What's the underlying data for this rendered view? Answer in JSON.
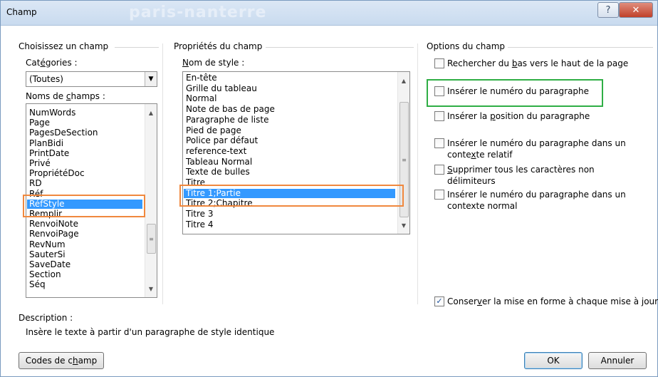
{
  "window": {
    "title": "Champ",
    "background_title": "paris-nanterre"
  },
  "left": {
    "group_title": "Choisissez un champ",
    "categories_label": "Catégories :",
    "categories_value": "(Toutes)",
    "names_label": "Noms de champs :",
    "field_names": [
      "NumWords",
      "Page",
      "PagesDeSection",
      "PlanBidi",
      "PrintDate",
      "Privé",
      "PropriétéDoc",
      "RD",
      "Réf",
      "RéfStyle",
      "Remplir",
      "RenvoiNote",
      "RenvoiPage",
      "RevNum",
      "SauterSi",
      "SaveDate",
      "Section",
      "Séq"
    ],
    "selected_field": "RéfStyle"
  },
  "middle": {
    "group_title": "Propriétés du champ",
    "style_label": "Nom de style :",
    "styles": [
      "En-tête",
      "Grille du tableau",
      "Normal",
      "Note de bas de page",
      "Paragraphe de liste",
      "Pied de page",
      "Police par défaut",
      "reference-text",
      "Tableau Normal",
      "Texte de bulles",
      "Titre",
      "Titre 1;Partie",
      "Titre 2;Chapitre",
      "Titre 3",
      "Titre 4"
    ],
    "selected_style": "Titre 1;Partie"
  },
  "right": {
    "group_title": "Options du champ",
    "options": [
      {
        "label": "Rechercher du bas vers le haut de la page",
        "checked": false
      },
      {
        "label": "Insérer le numéro du paragraphe",
        "checked": false
      },
      {
        "label": "Insérer la position du paragraphe",
        "checked": false
      },
      {
        "label": "Insérer le numéro du paragraphe dans un contexte relatif",
        "checked": false
      },
      {
        "label": "Supprimer tous les caractères non délimiteurs",
        "checked": false
      },
      {
        "label": "Insérer le numéro du paragraphe dans un contexte normal",
        "checked": false
      },
      {
        "label": "Conserver la mise en forme à chaque mise à jour",
        "checked": true
      }
    ]
  },
  "description": {
    "label": "Description :",
    "text": "Insère le texte à partir d'un paragraphe de style identique"
  },
  "buttons": {
    "field_codes": "Codes de champ",
    "ok": "OK",
    "cancel": "Annuler"
  },
  "colors": {
    "orange_highlight": "#f0883e",
    "green_highlight": "#2fae45",
    "selection": "#3399ff"
  }
}
